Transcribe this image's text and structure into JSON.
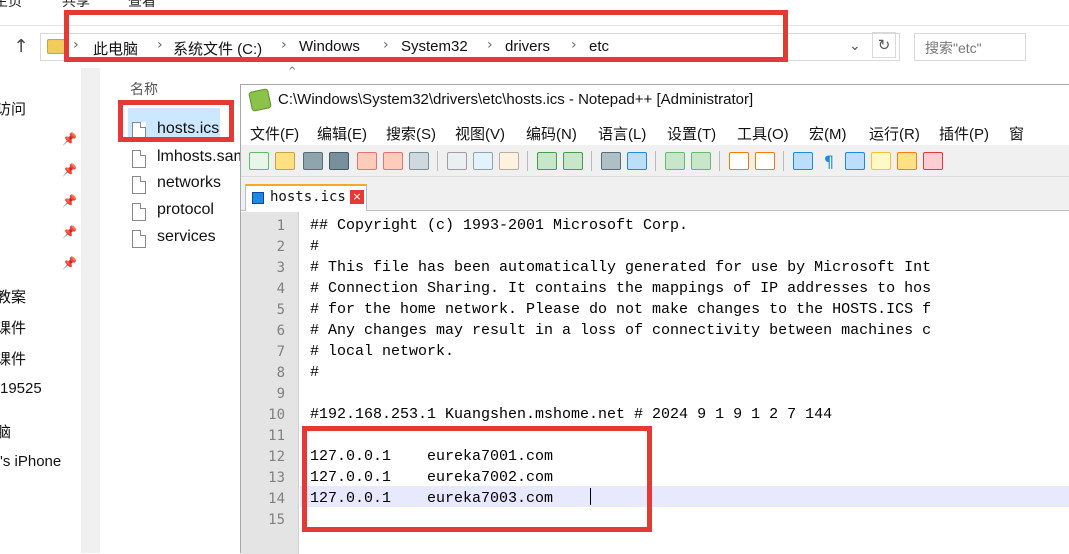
{
  "ribbon": {
    "tabs": [
      "主页",
      "共享",
      "查看"
    ]
  },
  "address": {
    "crumbs": [
      "此电脑",
      "系统文件 (C:)",
      "Windows",
      "System32",
      "drivers",
      "etc"
    ],
    "search_placeholder": "搜索\"etc\"",
    "dropdown_icon": "chevron-down-icon",
    "refresh_icon": "refresh-icon"
  },
  "navpane": {
    "items": [
      "访问",
      "教案",
      "课件",
      "课件",
      "19525",
      "脑",
      "'s iPhone"
    ]
  },
  "filelist": {
    "column_header": "名称",
    "files": [
      "hosts.ics",
      "lmhosts.sam",
      "networks",
      "protocol",
      "services"
    ]
  },
  "npp": {
    "title": "C:\\Windows\\System32\\drivers\\etc\\hosts.ics - Notepad++ [Administrator]",
    "menu": [
      "文件(F)",
      "编辑(E)",
      "搜索(S)",
      "视图(V)",
      "编码(N)",
      "语言(L)",
      "设置(T)",
      "工具(O)",
      "宏(M)",
      "运行(R)",
      "插件(P)",
      "窗"
    ],
    "tab_name": "hosts.ics",
    "lines": [
      "## Copyright (c) 1993-2001 Microsoft Corp.",
      "#",
      "# This file has been automatically generated for use by Microsoft Int",
      "# Connection Sharing. It contains the mappings of IP addresses to hos",
      "# for the home network. Please do not make changes to the HOSTS.ICS f",
      "# Any changes may result in a loss of connectivity between machines c",
      "# local network.",
      "#",
      "",
      "#192.168.253.1 Kuangshen.mshome.net # 2024 9 1 9 1 2 7 144",
      "",
      "127.0.0.1    eureka7001.com",
      "127.0.0.1    eureka7002.com",
      "127.0.0.1    eureka7003.com",
      ""
    ],
    "line_numbers": [
      "1",
      "2",
      "3",
      "4",
      "5",
      "6",
      "7",
      "8",
      "9",
      "10",
      "11",
      "12",
      "13",
      "14",
      "15"
    ]
  },
  "colors": {
    "annotation_red": "#e53935",
    "selection_blue": "#cce8ff",
    "current_line": "#e8e8ff"
  }
}
